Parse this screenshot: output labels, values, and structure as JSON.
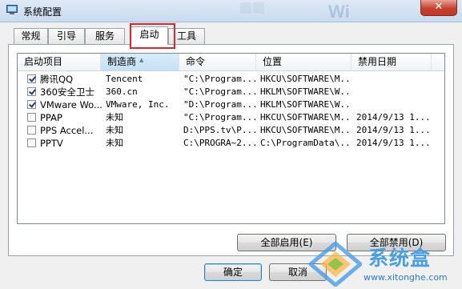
{
  "window": {
    "title": "系统配置",
    "close_symbol": "✕"
  },
  "tabs": [
    {
      "label": "常规",
      "active": false
    },
    {
      "label": "引导",
      "active": false
    },
    {
      "label": "服务",
      "active": false
    },
    {
      "label": "启动",
      "active": true
    },
    {
      "label": "工具",
      "active": false
    }
  ],
  "table": {
    "columns": [
      "启动项目",
      "制造商",
      "命令",
      "位置",
      "禁用日期"
    ],
    "rows": [
      {
        "checked": true,
        "name": "腾讯QQ",
        "maker": "Tencent",
        "command": "\"C:\\Program...",
        "location": "HKCU\\SOFTWARE\\M...",
        "date": ""
      },
      {
        "checked": true,
        "name": "360安全卫士",
        "maker": "360.cn",
        "command": "\"C:\\Program...",
        "location": "HKLM\\SOFTWARE\\W...",
        "date": ""
      },
      {
        "checked": true,
        "name": "VMware Wo...",
        "maker": "VMware, Inc.",
        "command": "\"D:\\Program...",
        "location": "HKLM\\SOFTWARE\\W...",
        "date": ""
      },
      {
        "checked": false,
        "name": "PPAP",
        "maker": "未知",
        "command": "\"C:\\Program...",
        "location": "HKCU\\SOFTWARE\\M...",
        "date": "2014/9/13 1..."
      },
      {
        "checked": false,
        "name": "PPS Accel...",
        "maker": "未知",
        "command": "D:\\PPS.tv\\P...",
        "location": "HKCU\\SOFTWARE\\M...",
        "date": "2014/9/13 1..."
      },
      {
        "checked": false,
        "name": "PPTV",
        "maker": "未知",
        "command": "C:\\PROGRA~2...",
        "location": "C:\\ProgramData\\...",
        "date": "2014/9/13 1..."
      }
    ]
  },
  "buttons": {
    "enable_all": "全部启用(E)",
    "disable_all": "全部禁用(D)",
    "ok": "确定",
    "cancel": "取消"
  },
  "watermark": {
    "brand": "系统盒",
    "url": "www.xitonghe.com"
  },
  "colors": {
    "highlight_box": "#e0242b",
    "watermark_blue": "#4a9ee4"
  }
}
